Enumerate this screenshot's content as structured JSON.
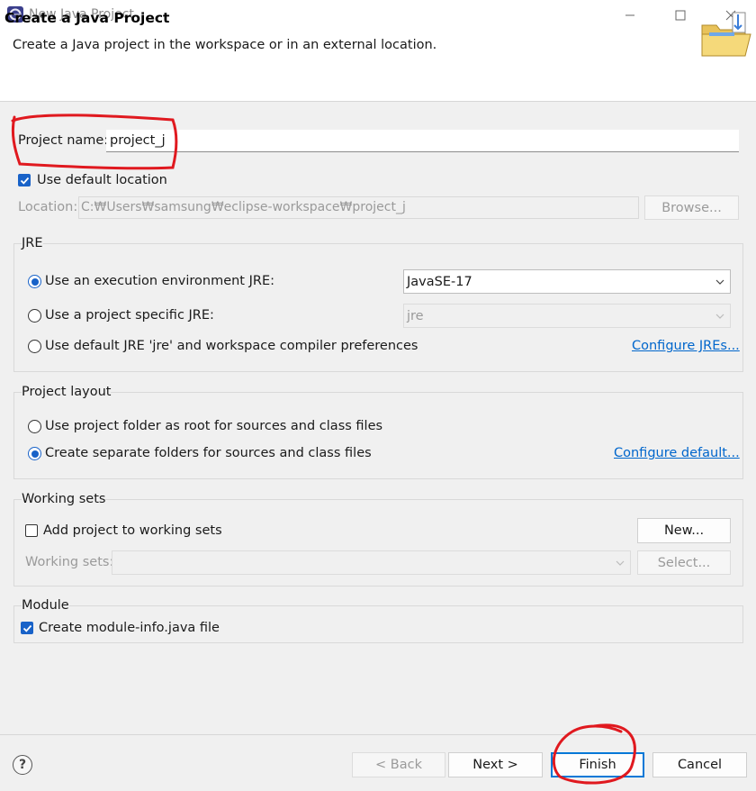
{
  "window": {
    "title": "New Java Project",
    "icon": "eclipse-icon",
    "controls": [
      "minimize-icon",
      "maximize-icon",
      "close-icon"
    ]
  },
  "banner": {
    "title": "Create a Java Project",
    "description": "Create a Java project in the workspace or in an external location.",
    "icon": "folder-icon"
  },
  "project_name": {
    "label": "Project name:",
    "value": "project_j"
  },
  "use_default_location": {
    "label": "Use default location",
    "checked": true
  },
  "location": {
    "label": "Location:",
    "value": "C:₩Users₩samsung₩eclipse-workspace₩project_j",
    "browse_label": "Browse..."
  },
  "jre": {
    "group_label": "JRE",
    "options": [
      {
        "label": "Use an execution environment JRE:",
        "selected": true
      },
      {
        "label": "Use a project specific JRE:",
        "selected": false
      },
      {
        "label": "Use default JRE 'jre' and workspace compiler preferences",
        "selected": false
      }
    ],
    "execution_env_value": "JavaSE-17",
    "project_jre_value": "jre",
    "configure_link": "Configure JREs..."
  },
  "project_layout": {
    "group_label": "Project layout",
    "options": [
      {
        "label": "Use project folder as root for sources and class files",
        "selected": false
      },
      {
        "label": "Create separate folders for sources and class files",
        "selected": true
      }
    ],
    "configure_link": "Configure default..."
  },
  "working_sets": {
    "group_label": "Working sets",
    "add_label": "Add project to working sets",
    "add_checked": false,
    "new_label": "New...",
    "sets_label": "Working sets:",
    "sets_value": "",
    "select_label": "Select..."
  },
  "module": {
    "group_label": "Module",
    "create_label": "Create module-info.java file",
    "create_checked": true
  },
  "footer": {
    "help_icon": "help-icon",
    "help_glyph": "?",
    "back_label": "< Back",
    "next_label": "Next >",
    "finish_label": "Finish",
    "cancel_label": "Cancel"
  },
  "annotation_color": "#e0191f",
  "accent_color": "#1862c8"
}
